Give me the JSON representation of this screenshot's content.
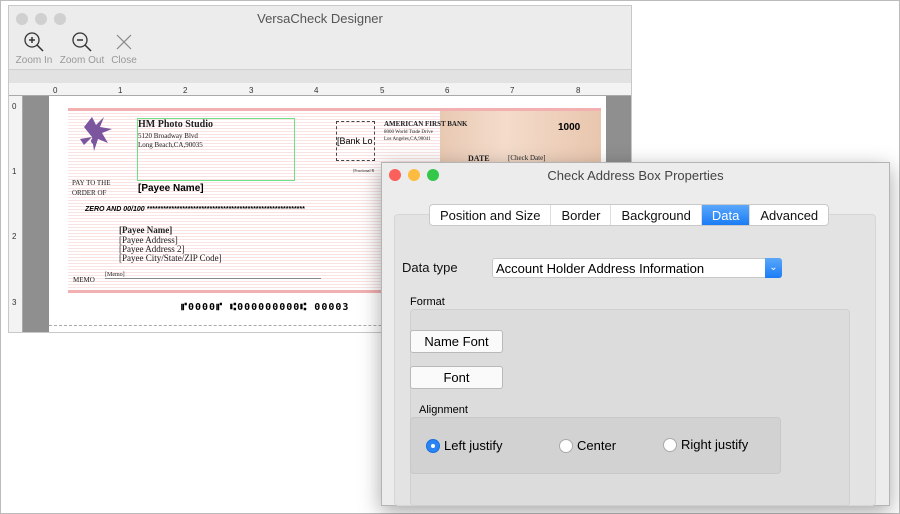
{
  "designer": {
    "title": "VersaCheck Designer",
    "toolbar": [
      {
        "label": "Zoom In",
        "icon": "zoom-in-icon"
      },
      {
        "label": "Zoom Out",
        "icon": "zoom-out-icon"
      },
      {
        "label": "Close",
        "icon": "close-icon"
      }
    ],
    "ruler_h": [
      "0",
      "1",
      "2",
      "3",
      "4",
      "5",
      "6",
      "7",
      "8"
    ],
    "ruler_v": [
      "0",
      "1",
      "2",
      "3"
    ]
  },
  "check": {
    "company": "HM Photo Studio",
    "address1": "5120 Broadway Blvd",
    "address2": "Long Beach,CA,90035",
    "bank_logo": "[Bank Lo",
    "bank_name": "AMERICAN FIRST BANK",
    "bank_addr1": "8000 World Trade Drive",
    "bank_addr2": "Los Angeles,CA,90041",
    "fractional": "[Fractional R",
    "check_no": "1000",
    "date_label": "DATE",
    "date_value": "[Check Date]",
    "pay_to1": "PAY TO THE",
    "pay_to2": "ORDER OF",
    "payee": "[Payee Name]",
    "amount_words": "ZERO AND 00/100 **********************************************************",
    "addr_name": "[Payee Name]",
    "addr_l1": "[Payee Address]",
    "addr_l2": "[Payee Address 2]",
    "addr_l3": "[Payee City/State/ZIP Code]",
    "memo_label": "MEMO",
    "memo": "[Memo]",
    "micr": "⑈0000⑈ ⑆000000000⑆ 00003"
  },
  "dialog": {
    "title": "Check Address Box Properties",
    "tabs": [
      "Position and Size",
      "Border",
      "Background",
      "Data",
      "Advanced"
    ],
    "selected_tab": "Data",
    "data_type_label": "Data type",
    "data_type_value": "Account Holder Address Information",
    "format_label": "Format",
    "name_font_button": "Name Font",
    "font_button": "Font",
    "alignment_label": "Alignment",
    "alignment_options": [
      "Left justify",
      "Center",
      "Right justify"
    ],
    "alignment_selected": "Left justify"
  },
  "colors": {
    "accent": "#1a7cf5",
    "check_border": "#f2b0b0",
    "selection": "#6de08a",
    "flower": "#7b559e"
  }
}
